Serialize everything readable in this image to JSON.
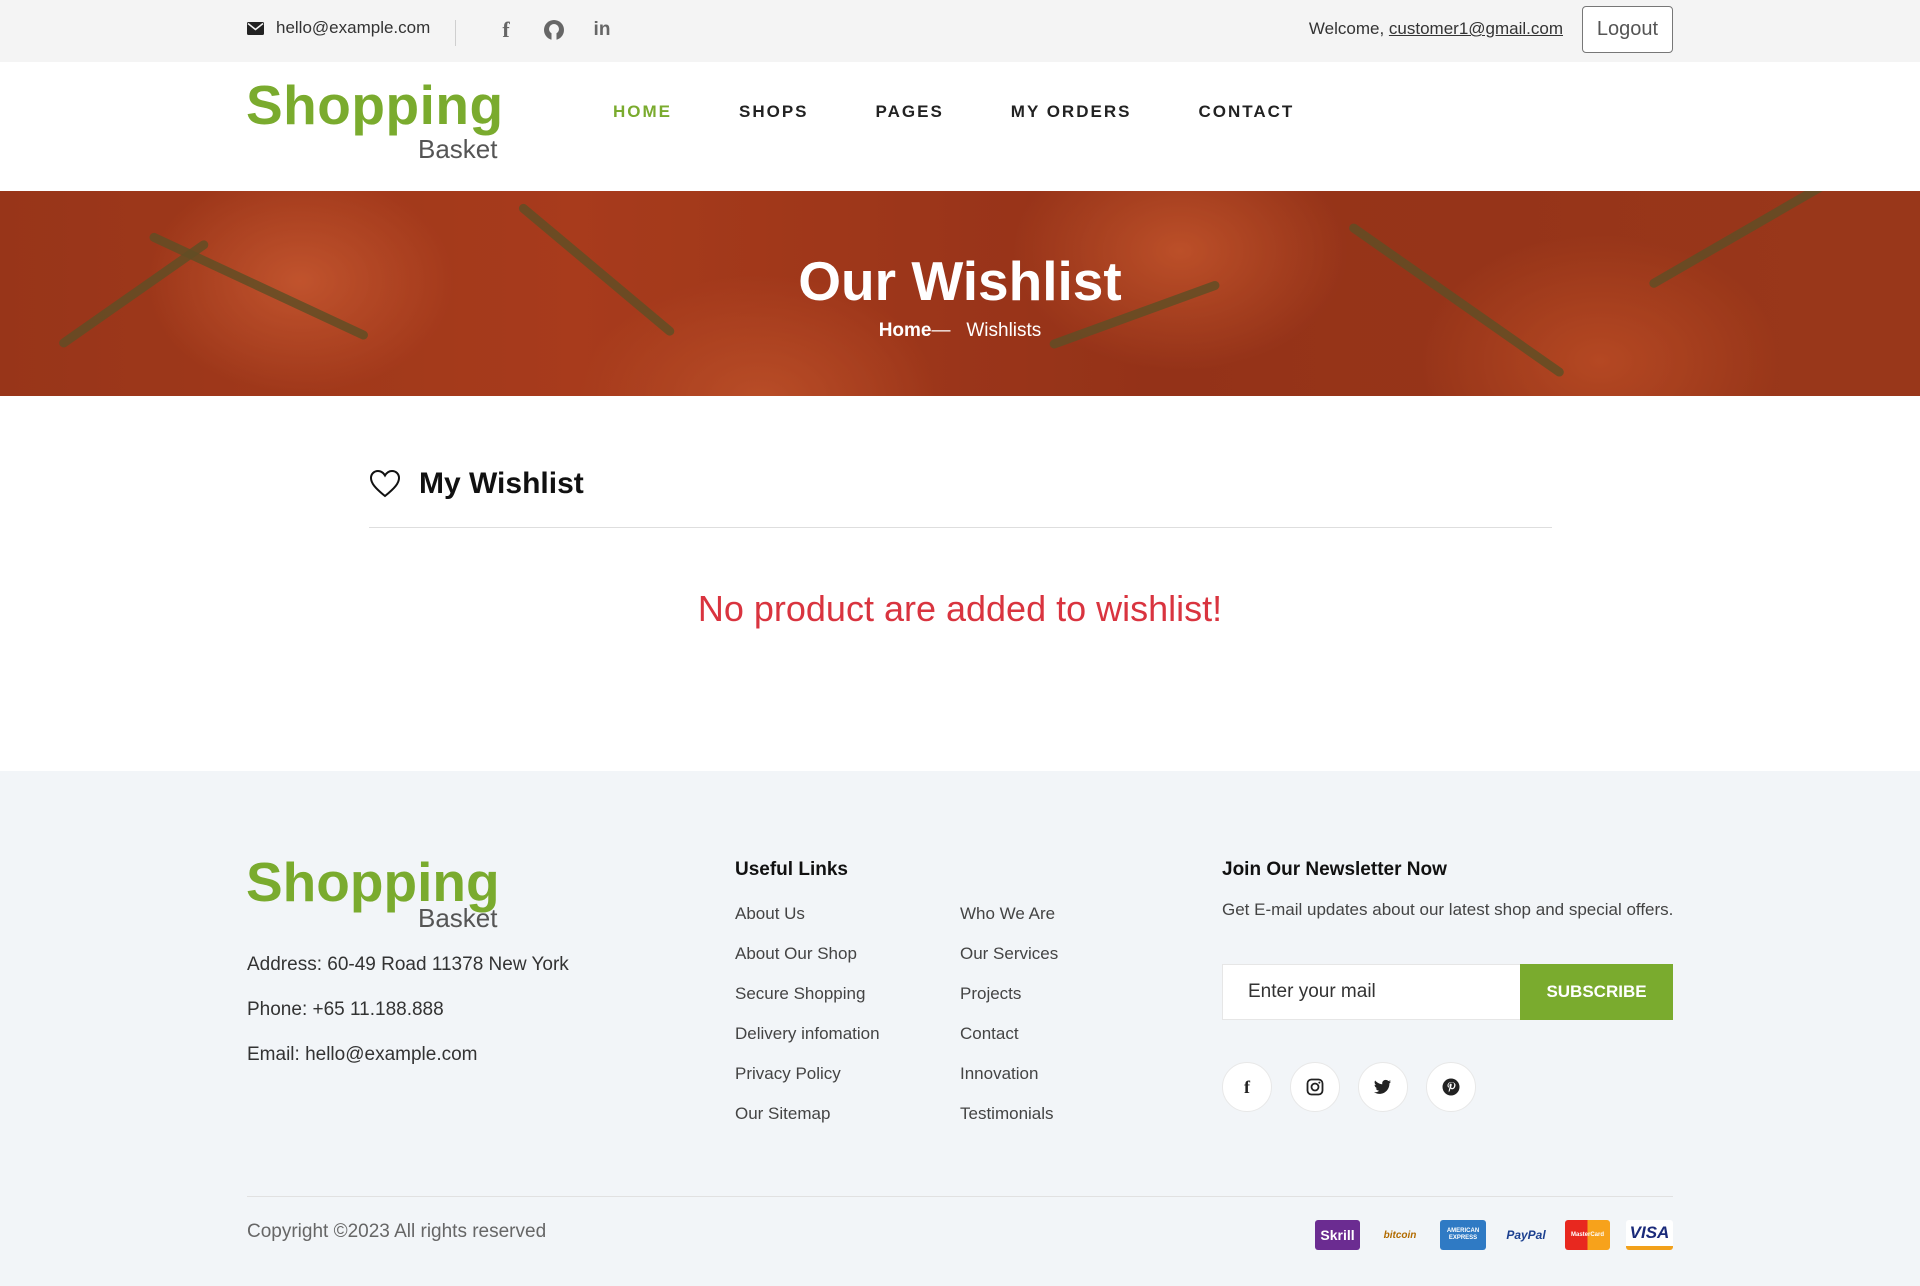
{
  "topbar": {
    "email": "hello@example.com",
    "welcome_text": "Welcome,",
    "user_email": "customer1@gmail.com",
    "logout_label": "Logout",
    "socials": [
      {
        "icon": "facebook-icon",
        "glyph": "f"
      },
      {
        "icon": "github-icon",
        "glyph": "●"
      },
      {
        "icon": "linkedin-icon",
        "glyph": "in"
      }
    ]
  },
  "brand": {
    "name": "Shopping",
    "sub": "Basket",
    "color": "#7aab2e"
  },
  "nav": {
    "items": [
      {
        "label": "HOME",
        "active": true
      },
      {
        "label": "SHOPS"
      },
      {
        "label": "PAGES"
      },
      {
        "label": "MY ORDERS"
      },
      {
        "label": "CONTACT"
      }
    ]
  },
  "hero": {
    "title": "Our Wishlist",
    "crumb_home": "Home",
    "crumb_sep": "—",
    "crumb_current": "Wishlists"
  },
  "wishlist": {
    "heading": "My Wishlist",
    "empty_message": "No product are added to wishlist!",
    "empty_color": "#d9343f"
  },
  "footer": {
    "address": "Address: 60-49 Road 11378 New York",
    "phone": "Phone: +65 11.188.888",
    "email": "Email: hello@example.com",
    "useful_links_title": "Useful Links",
    "links_col1": [
      "About Us",
      "About Our Shop",
      "Secure Shopping",
      "Delivery infomation",
      "Privacy Policy",
      "Our Sitemap"
    ],
    "links_col2": [
      "Who We Are",
      "Our Services",
      "Projects",
      "Contact",
      "Innovation",
      "Testimonials"
    ],
    "newsletter_title": "Join Our Newsletter Now",
    "newsletter_text": "Get E-mail updates about our latest shop and special offers.",
    "newsletter_placeholder": "Enter your mail",
    "subscribe_label": "SUBSCRIBE",
    "socials": [
      "facebook-icon",
      "instagram-icon",
      "twitter-icon",
      "pinterest-icon"
    ],
    "copyright": "Copyright ©2023 All rights reserved",
    "payments": [
      {
        "name": "Skrill",
        "icon": "skrill-icon",
        "bg": "#6b2c91",
        "fg": "#ffffff"
      },
      {
        "name": "bitcoin",
        "icon": "bitcoin-icon",
        "bg": "#f2f5f8",
        "fg": "#b26b00"
      },
      {
        "name": "AMERICAN EXPRESS",
        "icon": "amex-icon",
        "bg": "#2f7ac4",
        "fg": "#ffffff"
      },
      {
        "name": "PayPal",
        "icon": "paypal-icon",
        "bg": "#f2f5f8",
        "fg": "#1b3f8f"
      },
      {
        "name": "MasterCard",
        "icon": "mastercard-icon",
        "bg": "#e84a1f",
        "fg": "#ffffff"
      },
      {
        "name": "VISA",
        "icon": "visa-icon",
        "bg": "#ffffff",
        "fg": "#1a2a7a"
      }
    ]
  }
}
